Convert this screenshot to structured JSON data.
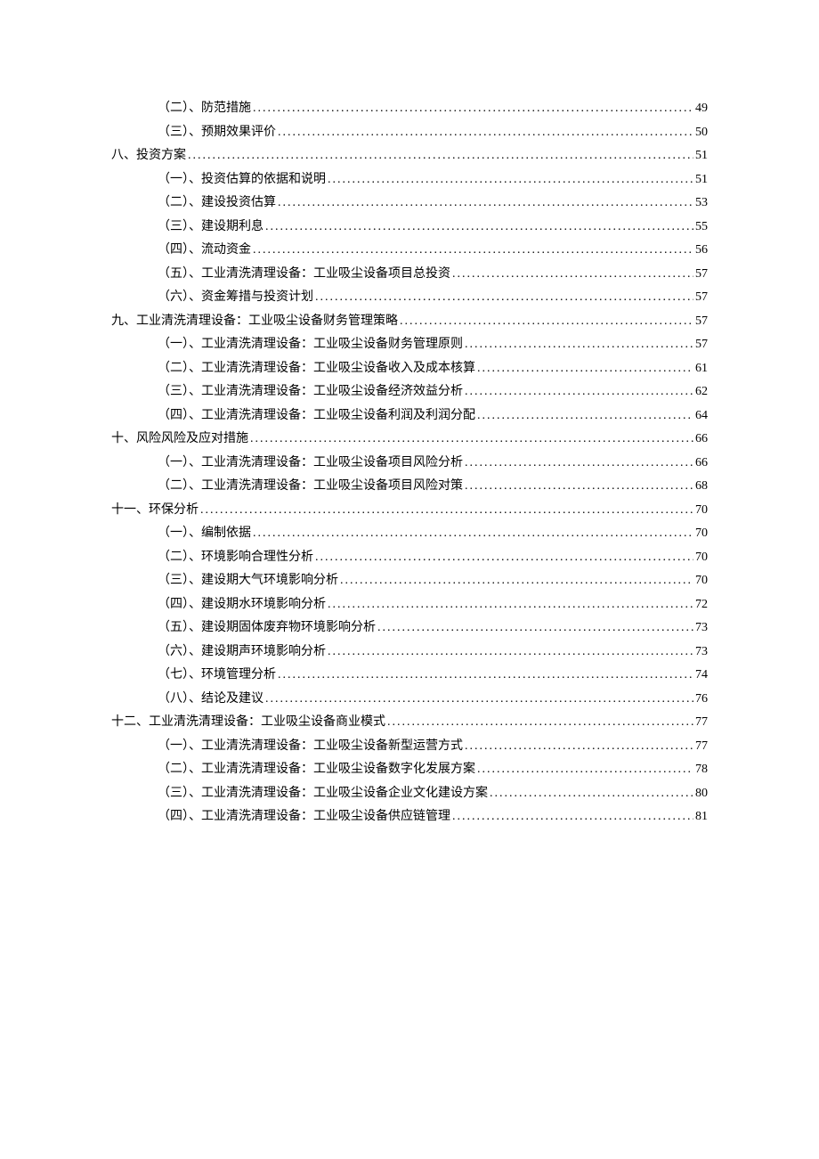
{
  "toc": [
    {
      "level": 2,
      "label": "（二）、防范措施",
      "page": "49"
    },
    {
      "level": 2,
      "label": "（三）、预期效果评价",
      "page": "50"
    },
    {
      "level": 1,
      "label": "八、投资方案",
      "page": "51"
    },
    {
      "level": 2,
      "label": "（一）、投资估算的依据和说明",
      "page": "51"
    },
    {
      "level": 2,
      "label": "（二）、建设投资估算",
      "page": "53"
    },
    {
      "level": 2,
      "label": "（三）、建设期利息",
      "page": "55"
    },
    {
      "level": 2,
      "label": "（四）、流动资金",
      "page": "56"
    },
    {
      "level": 2,
      "label": "（五）、工业清洗清理设备：工业吸尘设备项目总投资",
      "page": "57"
    },
    {
      "level": 2,
      "label": "（六）、资金筹措与投资计划",
      "page": "57"
    },
    {
      "level": 1,
      "label": "九、工业清洗清理设备：工业吸尘设备财务管理策略",
      "page": "57"
    },
    {
      "level": 2,
      "label": "（一）、工业清洗清理设备：工业吸尘设备财务管理原则",
      "page": "57"
    },
    {
      "level": 2,
      "label": "（二）、工业清洗清理设备：工业吸尘设备收入及成本核算",
      "page": "61"
    },
    {
      "level": 2,
      "label": "（三）、工业清洗清理设备：工业吸尘设备经济效益分析",
      "page": "62"
    },
    {
      "level": 2,
      "label": "（四）、工业清洗清理设备：工业吸尘设备利润及利润分配",
      "page": "64"
    },
    {
      "level": 1,
      "label": "十、风险风险及应对措施",
      "page": "66"
    },
    {
      "level": 2,
      "label": "（一）、工业清洗清理设备：工业吸尘设备项目风险分析",
      "page": "66"
    },
    {
      "level": 2,
      "label": "（二）、工业清洗清理设备：工业吸尘设备项目风险对策",
      "page": "68"
    },
    {
      "level": 1,
      "label": "十一、环保分析",
      "page": "70"
    },
    {
      "level": 2,
      "label": "（一）、编制依据",
      "page": "70"
    },
    {
      "level": 2,
      "label": "（二）、环境影响合理性分析",
      "page": "70"
    },
    {
      "level": 2,
      "label": "（三）、建设期大气环境影响分析",
      "page": "70"
    },
    {
      "level": 2,
      "label": "（四）、建设期水环境影响分析",
      "page": "72"
    },
    {
      "level": 2,
      "label": "（五）、建设期固体废弃物环境影响分析",
      "page": "73"
    },
    {
      "level": 2,
      "label": "（六）、建设期声环境影响分析",
      "page": "73"
    },
    {
      "level": 2,
      "label": "（七）、环境管理分析",
      "page": "74"
    },
    {
      "level": 2,
      "label": "（八）、结论及建议",
      "page": "76"
    },
    {
      "level": 1,
      "label": "十二、工业清洗清理设备：工业吸尘设备商业模式",
      "page": "77"
    },
    {
      "level": 2,
      "label": "（一）、工业清洗清理设备：工业吸尘设备新型运营方式",
      "page": "77"
    },
    {
      "level": 2,
      "label": "（二）、工业清洗清理设备：工业吸尘设备数字化发展方案",
      "page": "78"
    },
    {
      "level": 2,
      "label": "（三）、工业清洗清理设备：工业吸尘设备企业文化建设方案",
      "page": "80"
    },
    {
      "level": 2,
      "label": "（四）、工业清洗清理设备：工业吸尘设备供应链管理",
      "page": "81"
    }
  ]
}
